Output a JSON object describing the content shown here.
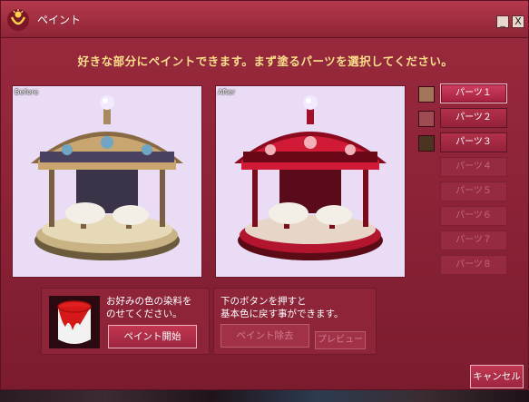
{
  "window": {
    "title": "ペイント",
    "minimize_label": "_",
    "close_label": "X"
  },
  "instruction": "好きな部分にペイントできます。まず塗るパーツを選択してください。",
  "previews": {
    "before_label": "Before",
    "after_label": "After"
  },
  "swatches": [
    "#a3765b",
    "#9e4b52",
    "#4a3522"
  ],
  "parts": [
    {
      "label": "パーツ１",
      "state": "active"
    },
    {
      "label": "パーツ２",
      "state": "enabled"
    },
    {
      "label": "パーツ３",
      "state": "enabled"
    },
    {
      "label": "パーツ４",
      "state": "disabled"
    },
    {
      "label": "パーツ５",
      "state": "disabled"
    },
    {
      "label": "パーツ６",
      "state": "disabled"
    },
    {
      "label": "パーツ７",
      "state": "disabled"
    },
    {
      "label": "パーツ８",
      "state": "disabled"
    }
  ],
  "dye_panel": {
    "line1": "お好みの色の染料を",
    "line2": "のせてください。",
    "start_button": "ペイント開始"
  },
  "reset_panel": {
    "line1": "下のボタンを押すと",
    "line2": "基本色に戻す事ができます。",
    "remove_button": "ペイント除去",
    "preview_button": "プレビュー"
  },
  "cancel_button": "キャンセル",
  "colors": {
    "window_bg": "#8a2236",
    "instruction_text": "#ffe08a",
    "active_part": "#cf3e60",
    "after_carousel": "#c0102e",
    "before_carousel": "#b08a5a"
  }
}
